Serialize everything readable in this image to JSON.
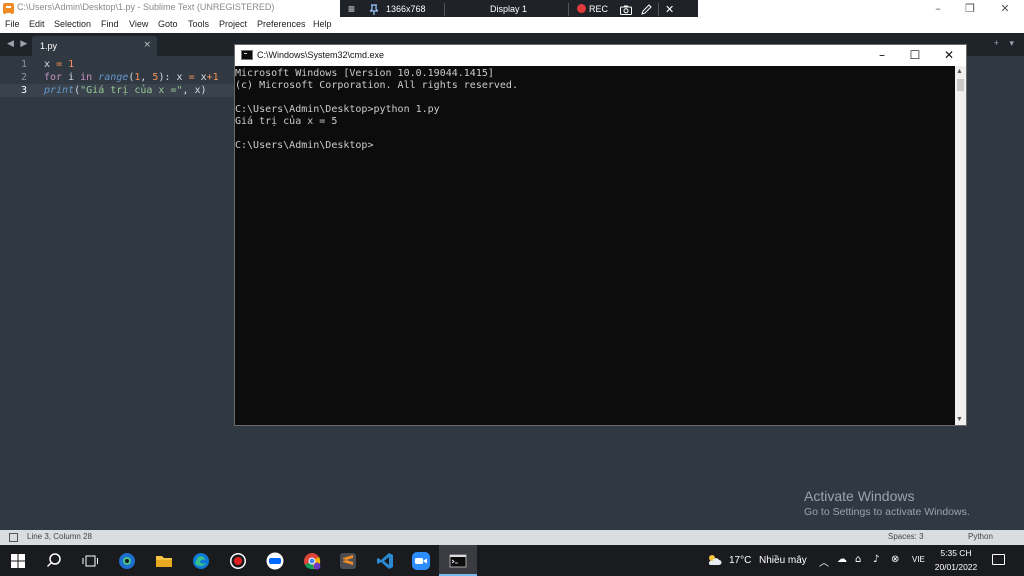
{
  "sublime": {
    "window_title": "C:\\Users\\Admin\\Desktop\\1.py - Sublime Text (UNREGISTERED)",
    "menu": [
      "File",
      "Edit",
      "Selection",
      "Find",
      "View",
      "Goto",
      "Tools",
      "Project",
      "Preferences",
      "Help"
    ],
    "tab": {
      "label": "1.py",
      "close": "×"
    },
    "tab_nav": "◀ ▶",
    "tab_extra": "+ ▾",
    "line_numbers": [
      "1",
      "2",
      "3"
    ],
    "active_line": 3,
    "code": [
      [
        {
          "t": "x",
          "c": "var"
        },
        {
          "t": " ",
          "c": "var"
        },
        {
          "t": "=",
          "c": "op"
        },
        {
          "t": " ",
          "c": "var"
        },
        {
          "t": "1",
          "c": "num"
        }
      ],
      [
        {
          "t": "for",
          "c": "kw"
        },
        {
          "t": " i ",
          "c": "var"
        },
        {
          "t": "in",
          "c": "kw"
        },
        {
          "t": " ",
          "c": "var"
        },
        {
          "t": "range",
          "c": "fn"
        },
        {
          "t": "(",
          "c": "var"
        },
        {
          "t": "1",
          "c": "num"
        },
        {
          "t": ", ",
          "c": "var"
        },
        {
          "t": "5",
          "c": "num"
        },
        {
          "t": "): x ",
          "c": "var"
        },
        {
          "t": "=",
          "c": "op"
        },
        {
          "t": " x",
          "c": "var"
        },
        {
          "t": "+",
          "c": "op"
        },
        {
          "t": "1",
          "c": "num"
        }
      ],
      [
        {
          "t": "print",
          "c": "fn"
        },
        {
          "t": "(",
          "c": "var"
        },
        {
          "t": "\"Giá trị của x =\"",
          "c": "str"
        },
        {
          "t": ", x)",
          "c": "var"
        }
      ]
    ]
  },
  "recorder": {
    "resolution": "1366x768",
    "display": "Display 1",
    "rec": "REC",
    "menu_icon": "≡",
    "pin_icon": "pin-icon"
  },
  "cmd": {
    "title": "C:\\Windows\\System32\\cmd.exe",
    "lines": [
      "Microsoft Windows [Version 10.0.19044.1415]",
      "(c) Microsoft Corporation. All rights reserved.",
      "",
      "C:\\Users\\Admin\\Desktop>python 1.py",
      "Giá trị của x = 5",
      "",
      "C:\\Users\\Admin\\Desktop>"
    ]
  },
  "activation": {
    "title": "Activate Windows",
    "subtitle": "Go to Settings to activate Windows."
  },
  "status": {
    "position": "Line 3, Column 28",
    "spaces": "Spaces: 3",
    "syntax": "Python"
  },
  "taskbar": {
    "apps": [
      "windows-start",
      "search",
      "task-view",
      "edge-beta",
      "file-explorer",
      "edge",
      "obs",
      "zalo",
      "chrome",
      "sublime-text",
      "vscode",
      "zoom",
      "cmd"
    ],
    "temperature": "17°C",
    "weather": "Nhiều mây",
    "language": "VIE",
    "time": "5:35 CH",
    "date": "20/01/2022"
  },
  "colors": {
    "editor_bg": "#303841",
    "keyword": "#c594c5",
    "function": "#6699cc",
    "string": "#99c794",
    "number": "#f99157"
  }
}
